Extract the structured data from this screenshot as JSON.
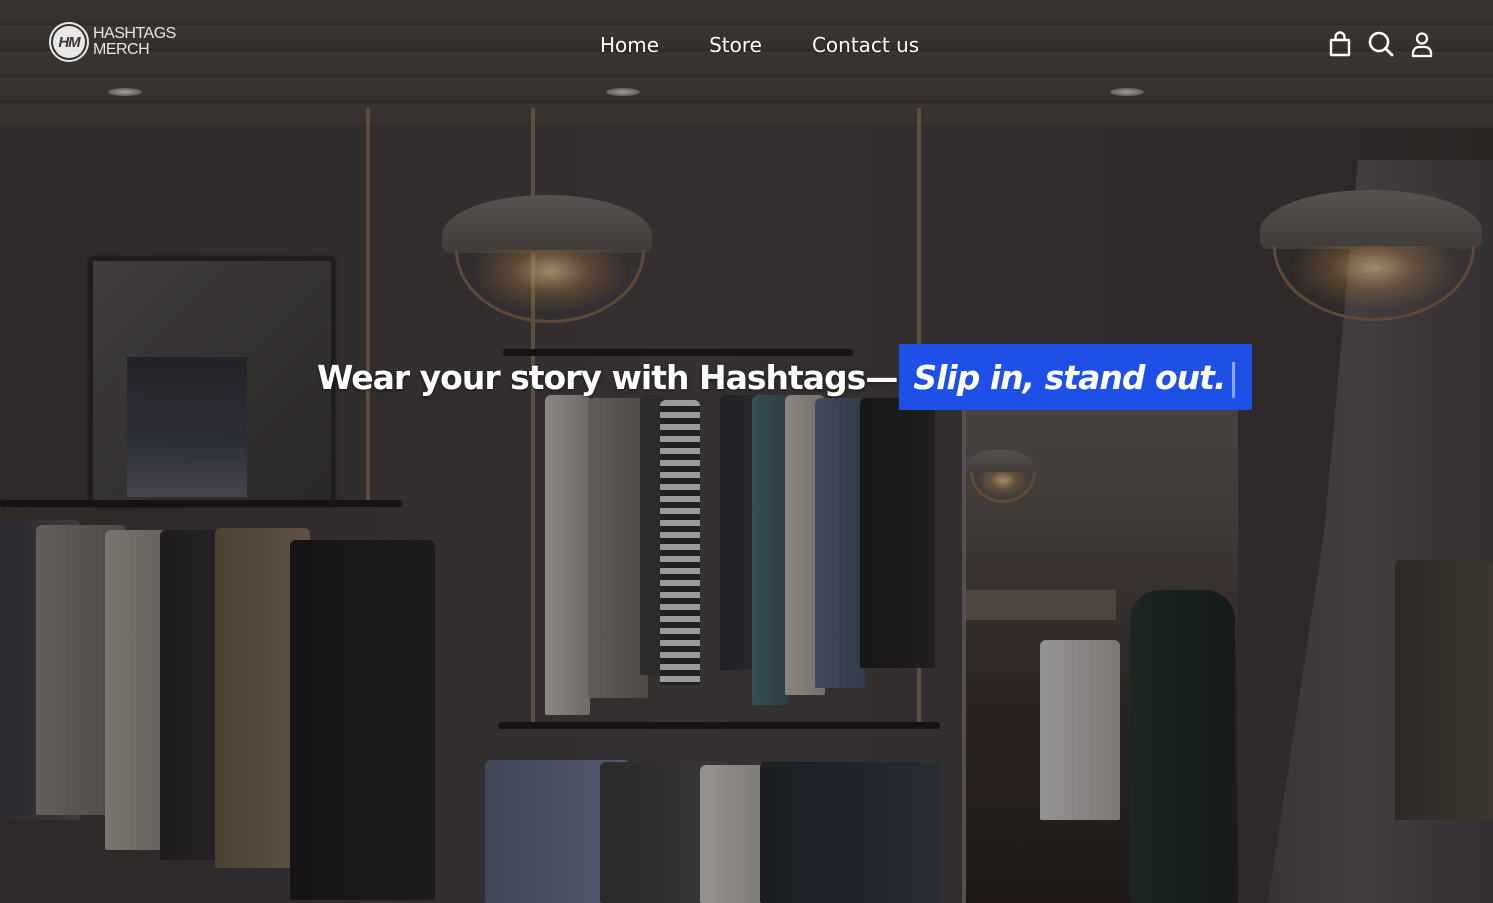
{
  "brand": {
    "logo_mark": "HM",
    "line1": "HASHTAGS",
    "line2": "MERCH"
  },
  "nav": {
    "items": [
      {
        "label": "Home"
      },
      {
        "label": "Store"
      },
      {
        "label": "Contact us"
      }
    ]
  },
  "header_icons": [
    "shopping-bag-icon",
    "search-icon",
    "user-icon"
  ],
  "hero": {
    "headline": "Wear your story with Hashtags—",
    "highlight": "Slip in, stand out.",
    "cursor": "|",
    "highlight_color": "#1e4fe6"
  }
}
